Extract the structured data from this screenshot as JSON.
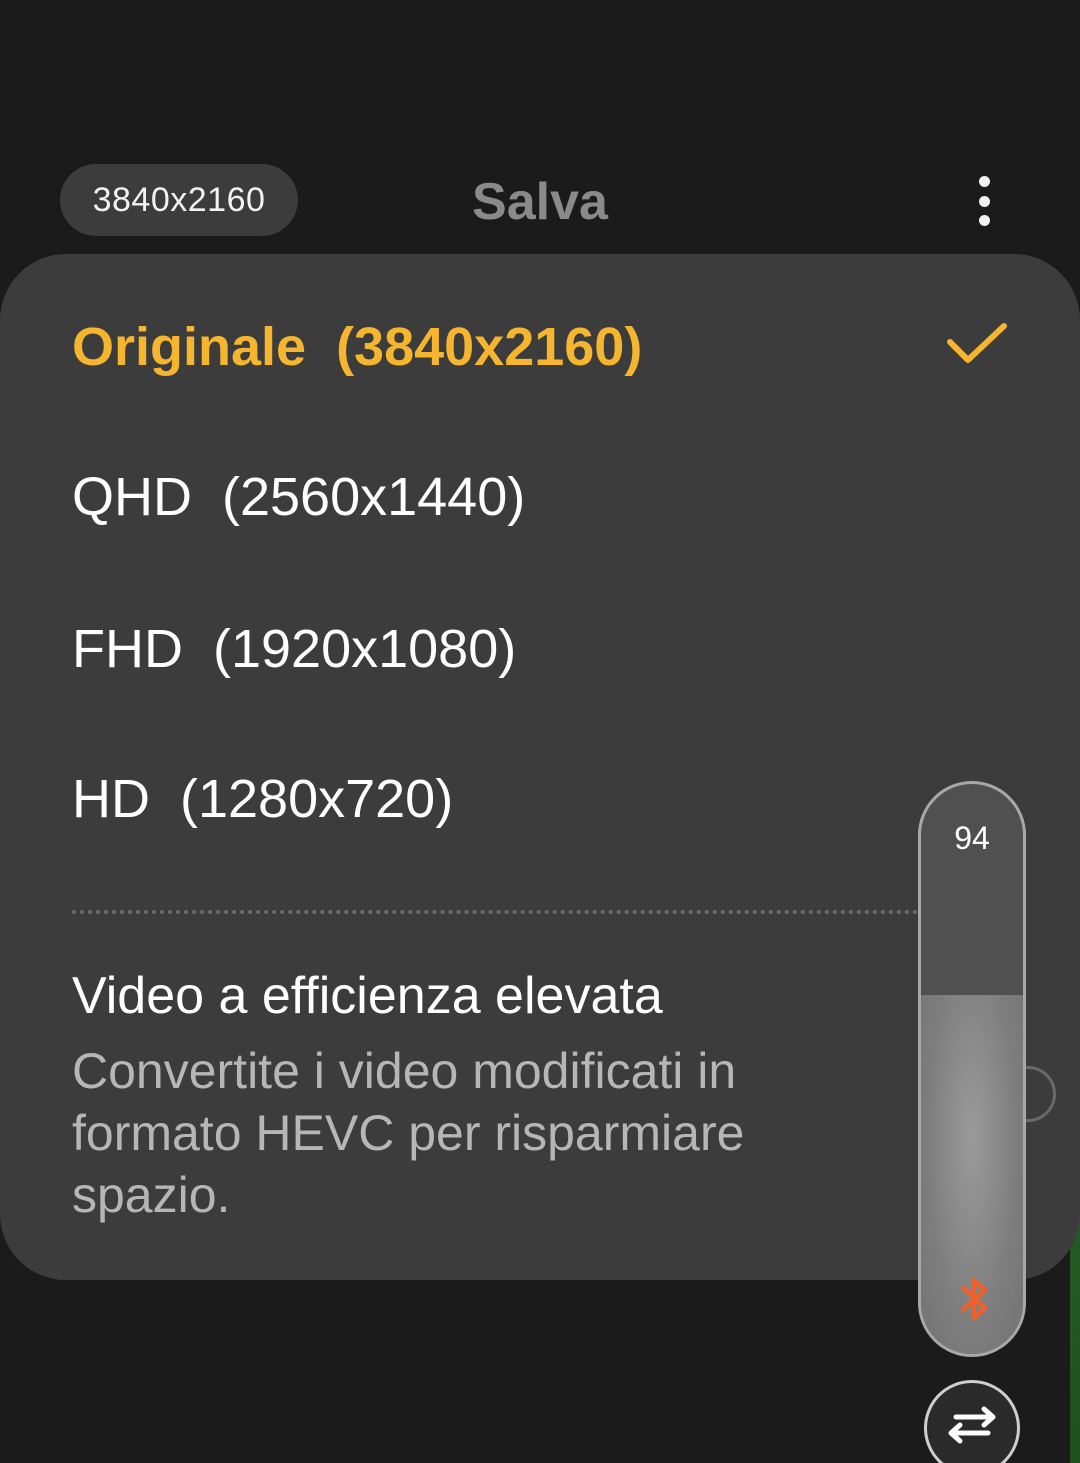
{
  "top_bar": {
    "resolution_badge": "3840x2160",
    "title": "Salva",
    "more_icon": "more-vertical-icon"
  },
  "resolution_menu": {
    "options": [
      {
        "label": "Originale  (3840x2160)",
        "selected": true
      },
      {
        "label": "QHD  (2560x1440)",
        "selected": false
      },
      {
        "label": "FHD  (1920x1080)",
        "selected": false
      },
      {
        "label": "HD  (1280x720)",
        "selected": false
      }
    ],
    "selected_icon": "check-icon",
    "hevc": {
      "title": "Video a efficienza elevata",
      "description": "Convertite i video modificati in formato HEVC per risparmiare spazio."
    }
  },
  "volume_overlay": {
    "value": "94",
    "level_percent": 63,
    "output_icon": "bluetooth-icon"
  },
  "swap_button": {
    "icon": "swap-arrows-icon"
  },
  "colors": {
    "background": "#1b1b1b",
    "panel": "#3c3c3c",
    "accent": "#f5b52e",
    "bluetooth": "#f0602a"
  }
}
